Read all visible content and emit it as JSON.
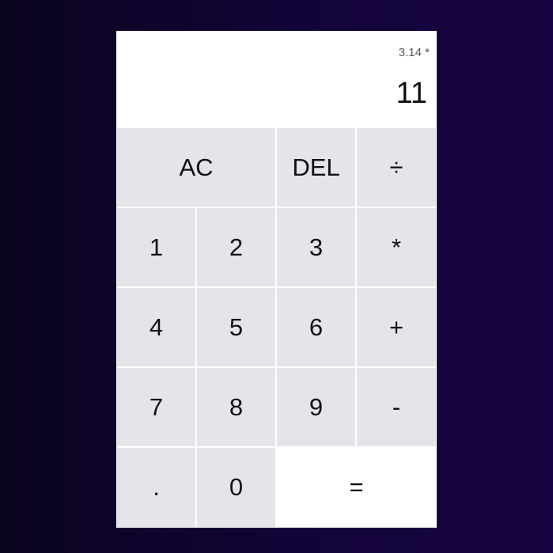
{
  "display": {
    "previous_operand": "3.14 *",
    "current_operand": "11"
  },
  "keys": {
    "clear": "AC",
    "delete": "DEL",
    "divide": "÷",
    "one": "1",
    "two": "2",
    "three": "3",
    "multiply": "*",
    "four": "4",
    "five": "5",
    "six": "6",
    "add": "+",
    "seven": "7",
    "eight": "8",
    "nine": "9",
    "subtract": "-",
    "decimal": ".",
    "zero": "0",
    "equals": "="
  },
  "colors": {
    "key_background": "#e6e4e9",
    "display_background": "#ffffff",
    "page_gradient_start": "#0b0420",
    "page_gradient_end": "#170341"
  }
}
